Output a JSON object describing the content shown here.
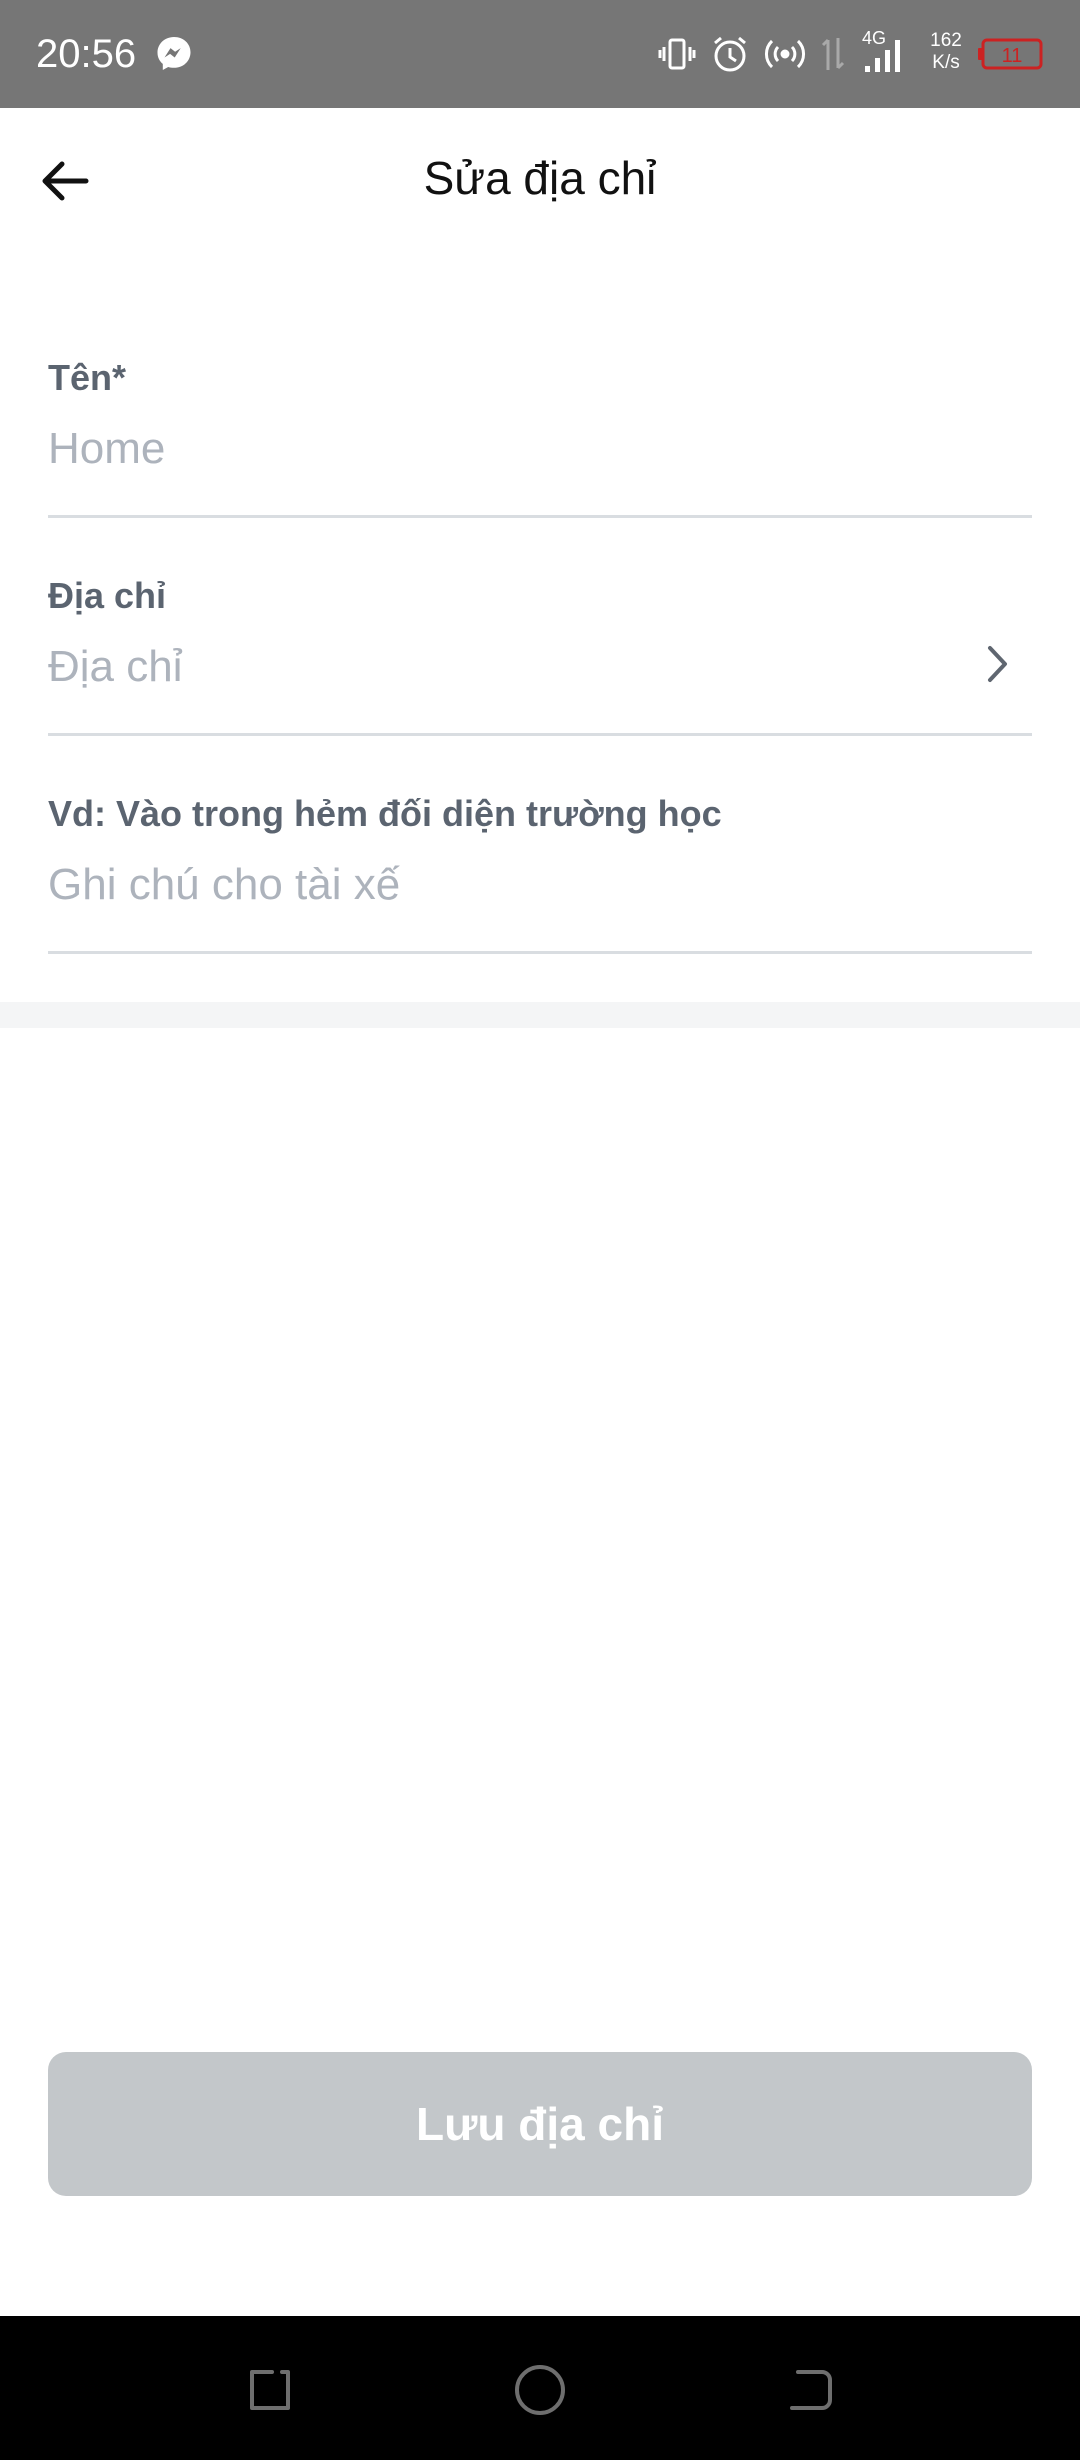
{
  "status_bar": {
    "time": "20:56",
    "net_type": "4G",
    "speed_value": "162",
    "speed_unit": "K/s",
    "battery": "11",
    "icons": [
      "messenger-icon",
      "vibrate-icon",
      "alarm-icon",
      "hotspot-icon",
      "data-arrows-icon",
      "signal-icon",
      "battery-icon"
    ]
  },
  "header": {
    "title": "Sửa địa chỉ",
    "back_icon": "arrow-left-icon"
  },
  "form": {
    "name": {
      "label": "Tên*",
      "placeholder": "Home",
      "value": ""
    },
    "address": {
      "label": "Địa chỉ",
      "placeholder": "Địa chỉ",
      "value": "",
      "chevron_icon": "chevron-right-icon"
    },
    "note": {
      "label": "Vd: Vào trong hẻm đối diện trường học",
      "placeholder": "Ghi chú cho tài xế",
      "value": ""
    }
  },
  "actions": {
    "save_label": "Lưu địa chỉ"
  },
  "nav": {
    "icons": [
      "recent-apps-icon",
      "home-icon",
      "back-icon"
    ]
  },
  "colors": {
    "status_bar_bg": "#767676",
    "label": "#5b6470",
    "placeholder": "#adb3bc",
    "field_border": "#d9dde1",
    "button_disabled": "#c3c7ca",
    "battery_low": "#cc2222"
  }
}
